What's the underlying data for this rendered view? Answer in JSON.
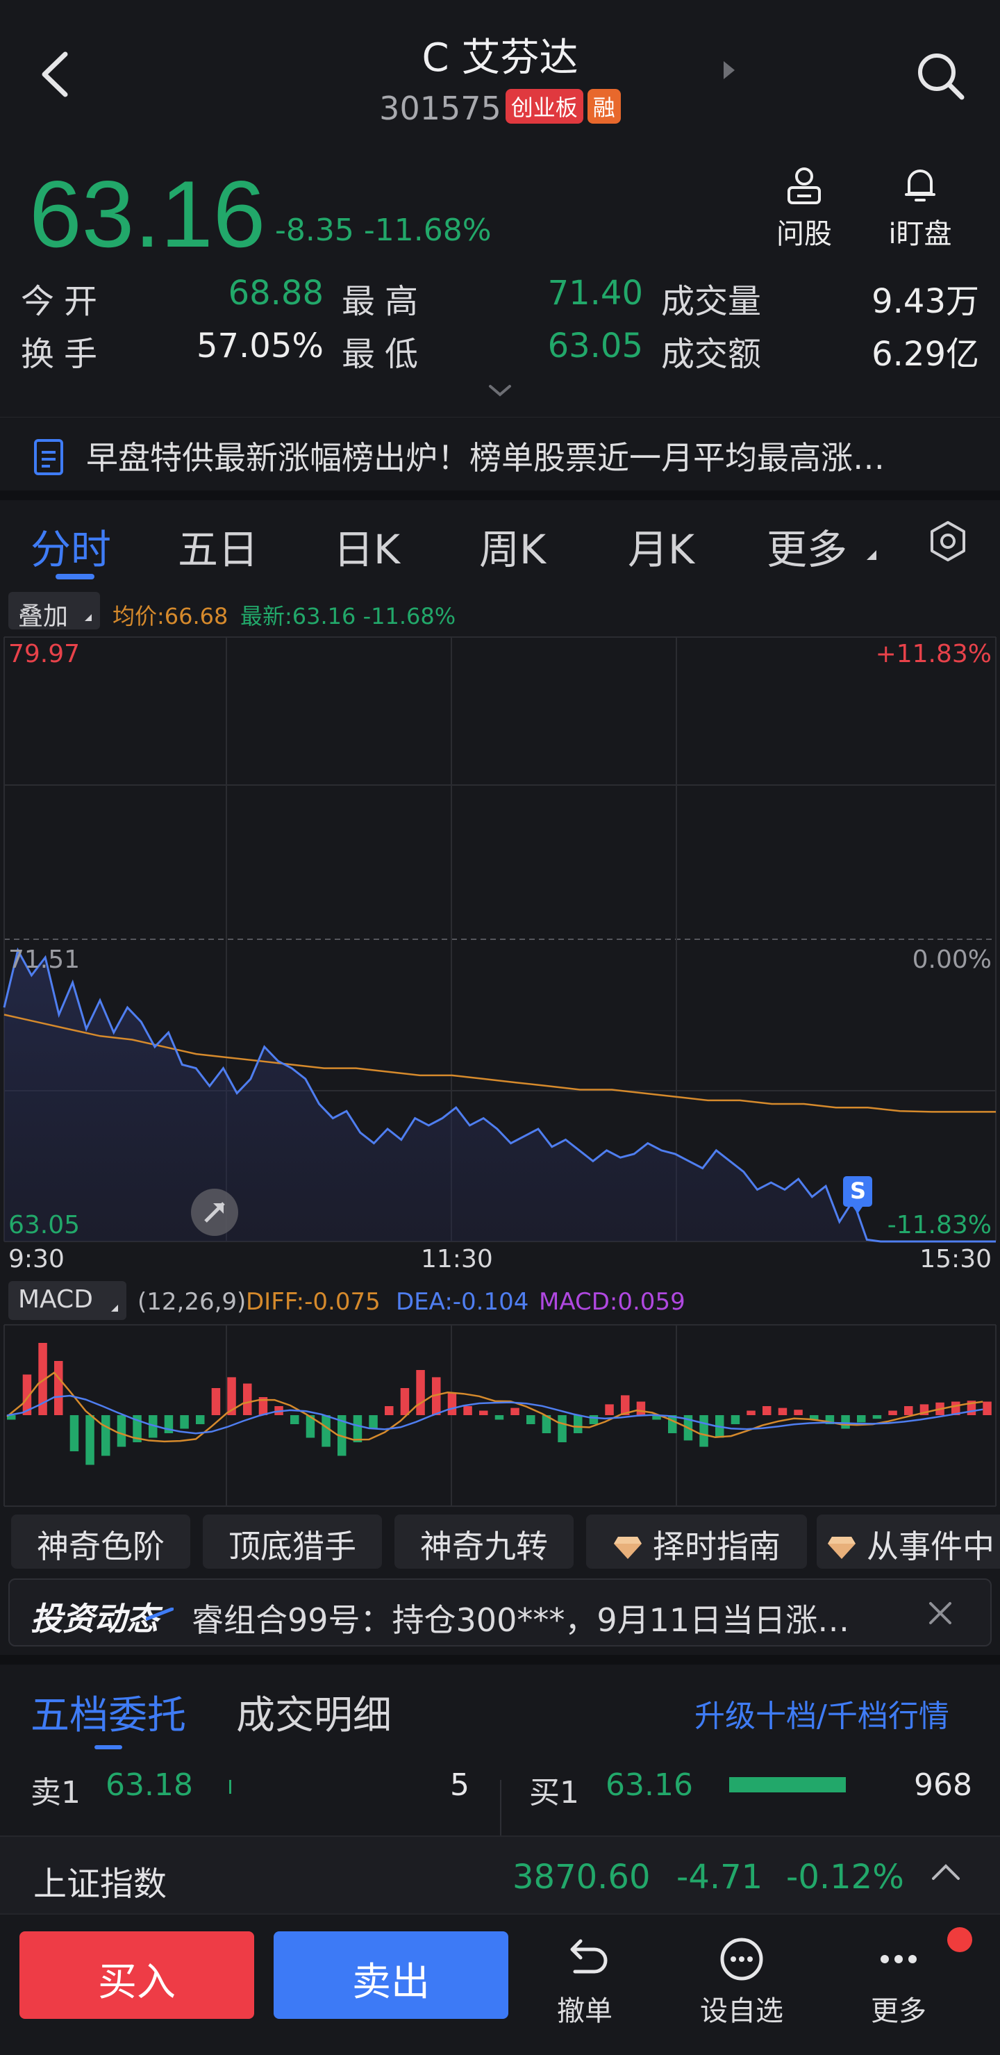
{
  "header": {
    "title": "C 艾芬达",
    "code": "301575",
    "board_badge": "创业板",
    "margin_badge": "融"
  },
  "quote": {
    "price": "63.16",
    "change": "-8.35",
    "change_pct": "-11.68%",
    "tools": [
      {
        "label": "问股",
        "icon": "person-icon"
      },
      {
        "label": "i盯盘",
        "icon": "bell-icon"
      }
    ],
    "stats": {
      "open_label": "今开",
      "open": "68.88",
      "high_label": "最高",
      "high": "71.40",
      "volume_label": "成交量",
      "volume": "9.43万",
      "turnover_label": "换手",
      "turnover": "57.05%",
      "low_label": "最低",
      "low": "63.05",
      "amount_label": "成交额",
      "amount": "6.29亿"
    }
  },
  "news": {
    "text": "早盘特供最新涨幅榜出炉！榜单股票近一月平均最高涨…"
  },
  "tabs": [
    "分时",
    "五日",
    "日K",
    "周K",
    "月K",
    "更多"
  ],
  "overlay": {
    "button": "叠加",
    "avg": "均价:66.68",
    "latest": "最新:63.16 -11.68%"
  },
  "intraday": {
    "y_top": "79.97",
    "y_mid": "71.51",
    "y_bottom": "63.05",
    "pct_top": "+11.83%",
    "pct_mid": "0.00%",
    "pct_bottom": "-11.83%",
    "time_start": "9:30",
    "time_mid": "11:30",
    "time_end": "15:30",
    "sell_marker": "S"
  },
  "chart_data": {
    "type": "line",
    "x_range": [
      "9:30",
      "15:30"
    ],
    "ylim": [
      63.05,
      79.97
    ],
    "reference": 71.51,
    "series": [
      {
        "values": [
          69.6,
          71.2,
          70.5,
          71.0,
          69.4,
          70.3,
          69.0,
          69.8,
          68.9,
          69.6,
          69.2,
          68.5,
          68.9,
          68.0,
          67.9,
          67.4,
          67.9,
          67.2,
          67.6,
          68.5,
          68.1,
          67.9,
          67.6,
          66.9,
          66.5,
          66.7,
          66.1,
          65.8,
          66.2,
          65.9,
          66.5,
          66.3,
          66.5,
          66.8,
          66.3,
          66.5,
          66.2,
          65.8,
          66.0,
          66.2,
          65.7,
          65.9,
          65.6,
          65.3,
          65.6,
          65.4,
          65.5,
          65.8,
          65.6,
          65.5,
          65.3,
          65.1,
          65.6,
          65.3,
          65.0,
          64.5,
          64.7,
          64.5,
          64.8,
          64.3,
          64.6,
          63.6,
          64.2,
          63.1,
          63.05
        ]
      },
      {
        "values": [
          69.4,
          69.2,
          69.0,
          68.8,
          68.7,
          68.5,
          68.3,
          68.2,
          68.1,
          68.0,
          67.9,
          67.9,
          67.8,
          67.7,
          67.7,
          67.6,
          67.5,
          67.4,
          67.3,
          67.3,
          67.2,
          67.1,
          67.0,
          67.0,
          66.9,
          66.9,
          66.8,
          66.8,
          66.7,
          66.68,
          66.68,
          66.68
        ]
      }
    ]
  },
  "macd": {
    "button": "MACD",
    "params": "(12,26,9)",
    "diff": "DIFF:-0.075",
    "dea": "DEA:-0.104",
    "macd": "MACD:0.059",
    "bars": [
      -0.05,
      0.45,
      0.8,
      0.6,
      -0.4,
      -0.55,
      -0.45,
      -0.35,
      -0.3,
      -0.25,
      -0.2,
      -0.15,
      -0.1,
      0.3,
      0.42,
      0.35,
      0.2,
      0.1,
      -0.1,
      -0.25,
      -0.35,
      -0.45,
      -0.3,
      -0.15,
      0.1,
      0.3,
      0.5,
      0.42,
      0.25,
      0.1,
      0.05,
      -0.05,
      0.08,
      -0.1,
      -0.2,
      -0.3,
      -0.2,
      -0.1,
      0.12,
      0.22,
      0.15,
      -0.05,
      -0.2,
      -0.28,
      -0.35,
      -0.25,
      -0.1,
      0.05,
      0.1,
      0.08,
      0.06,
      -0.05,
      -0.1,
      -0.15,
      -0.08,
      -0.04,
      0.05,
      0.1,
      0.12,
      0.14,
      0.15,
      0.16,
      0.15
    ]
  },
  "features": [
    {
      "label": "神奇色阶",
      "icon": ""
    },
    {
      "label": "顶底猎手",
      "icon": ""
    },
    {
      "label": "神奇九转",
      "icon": ""
    },
    {
      "label": "择时指南",
      "icon": "diamond-icon"
    },
    {
      "label": "从事件中",
      "icon": "diamond-icon"
    }
  ],
  "invest": {
    "title": "投资动态",
    "text": "睿组合99号：持仓300***，9月11日当日涨…"
  },
  "book": {
    "tab_active": "五档委托",
    "tab_other": "成交明细",
    "upgrade": "升级十档/千档行情",
    "sell1_label": "卖1",
    "sell1_price": "63.18",
    "sell1_qty": "5",
    "buy1_label": "买1",
    "buy1_price": "63.16",
    "buy1_qty": "968"
  },
  "index_bar": {
    "name": "上证指数",
    "value": "3870.60",
    "change": "-4.71",
    "pct": "-0.12%"
  },
  "bottom": {
    "buy": "买入",
    "sell": "卖出",
    "nav": [
      {
        "label": "撤单",
        "icon": "undo-icon"
      },
      {
        "label": "设自选",
        "icon": "dots-circle-icon"
      },
      {
        "label": "更多",
        "icon": "more-icon"
      }
    ]
  },
  "colors": {
    "down": "#22a86a",
    "up": "#e8424a",
    "accent": "#3f7cf6",
    "avg_line": "#d68a2c"
  }
}
